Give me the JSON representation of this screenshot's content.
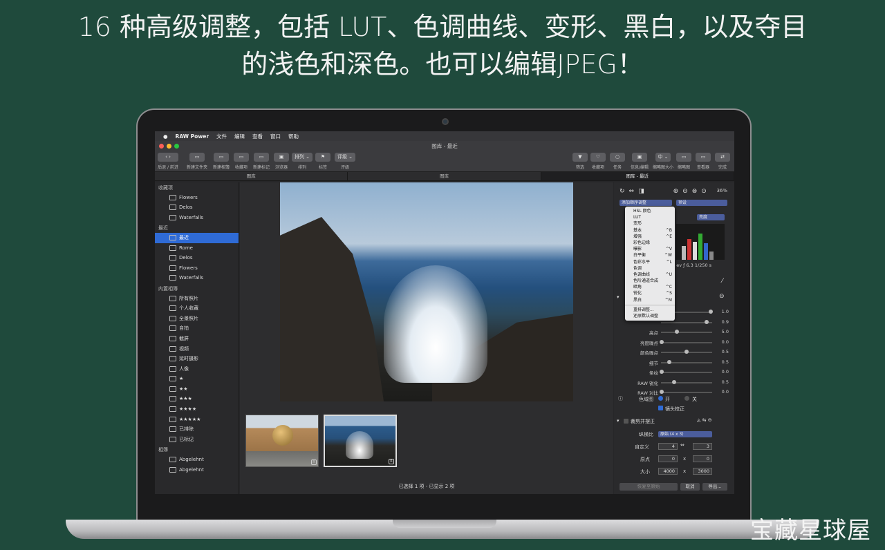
{
  "headline": {
    "line1": "16 种高级调整，包括 LUT、色调曲线、变形、黑白，以及夺目",
    "line2": "的浅色和深色。也可以编辑JPEG！"
  },
  "menubar": {
    "app": "RAW Power",
    "items": [
      "文件",
      "编辑",
      "查看",
      "窗口",
      "帮助"
    ]
  },
  "window": {
    "title": "图库 - 最近"
  },
  "toolbar": {
    "left": [
      {
        "label": "后退 / 前进",
        "icon": "‹ ›"
      },
      {
        "label": "新建文件夹",
        "icon": "▭"
      },
      {
        "label": "新建相簿",
        "icon": "▭"
      },
      {
        "label": "收藏项",
        "icon": "▭"
      },
      {
        "label": "新建标记",
        "icon": "▭"
      },
      {
        "label": "浏览器",
        "icon": "▣"
      },
      {
        "label": "排列",
        "icon": "排列 ⌄"
      },
      {
        "label": "标签",
        "icon": "⚑"
      },
      {
        "label": "评级",
        "icon": "评级 ⌄"
      }
    ],
    "right": [
      {
        "label": "筛选",
        "icon": "▼"
      },
      {
        "label": "收藏项",
        "icon": "♡"
      },
      {
        "label": "任务",
        "icon": "○"
      },
      {
        "label": "信息/编辑",
        "icon": "▣"
      },
      {
        "label": "缩略图大小",
        "icon": "中 ⌄"
      },
      {
        "label": "缩略图",
        "icon": "▭"
      },
      {
        "label": "查看器",
        "icon": "▭"
      },
      {
        "label": "完成",
        "icon": "⇄"
      }
    ]
  },
  "tabs": [
    "图库",
    "图库",
    "图库 - 最近"
  ],
  "sidebar": {
    "sections": [
      {
        "title": "收藏项",
        "items": [
          "Flowers",
          "Delos",
          "Waterfalls"
        ]
      },
      {
        "title": "最近",
        "items": [
          "最近",
          "Rome",
          "Delos",
          "Flowers",
          "Waterfalls"
        ]
      },
      {
        "title": "内置相簿",
        "items": [
          "所有照片",
          "个人收藏",
          "全景照片",
          "自拍",
          "截屏",
          "视频",
          "延时摄影",
          "人像",
          "★",
          "★★",
          "★★★",
          "★★★★",
          "★★★★★",
          "已排除",
          "已标记"
        ]
      },
      {
        "title": "相簿",
        "items": [
          "Abgelehnt",
          "Abgelehnt"
        ]
      }
    ],
    "selected": "最近"
  },
  "main": {
    "status": "已选择 1 项 - 已显示 2 项",
    "thumb_badge": "R"
  },
  "right": {
    "zoom": "36%",
    "combo_left": "添加顺序调整",
    "combo_right": "预设",
    "histogram_mode": "亮度",
    "exif": "0 ev  ƒ 6.3  1/250 s",
    "sliders": [
      {
        "label": "",
        "value": "1.0",
        "pos": 0.98
      },
      {
        "label": "",
        "value": "0.9",
        "pos": 0.9
      },
      {
        "label": "高点",
        "value": "5.0",
        "pos": 0.3
      },
      {
        "label": "亮度噪点",
        "value": "0.0",
        "pos": 0.0
      },
      {
        "label": "颜色噪点",
        "value": "0.5",
        "pos": 0.5
      },
      {
        "label": "细节",
        "value": "0.5",
        "pos": 0.15
      },
      {
        "label": "条纹",
        "value": "0.0",
        "pos": 0.0
      },
      {
        "label": "RAW 锐化",
        "value": "0.5",
        "pos": 0.25
      },
      {
        "label": "RAW 对比",
        "value": "0.0",
        "pos": 0.0
      }
    ],
    "color_map": "色域图",
    "on": "开",
    "off": "关",
    "lens_correction": "镜头校正",
    "crop_section": "裁剪并摆正",
    "aspect_label": "纵横比",
    "aspect_value": "原始 (4 x 3)",
    "custom_label": "自定义",
    "custom_w": "4",
    "custom_h": "3",
    "origin_label": "原点",
    "origin_x": "0",
    "origin_y": "0",
    "size_label": "大小",
    "size_w": "4000",
    "size_h": "3000",
    "times": "x",
    "restore_btn": "恢复至原始",
    "cancel_btn": "取消",
    "export_btn": "导出…"
  },
  "adjust_menu": [
    {
      "label": "HSL 颜色",
      "shortcut": ""
    },
    {
      "label": "LUT",
      "shortcut": ""
    },
    {
      "label": "变形",
      "shortcut": ""
    },
    {
      "label": "基本",
      "shortcut": "^B"
    },
    {
      "label": "增强",
      "shortcut": "^E"
    },
    {
      "label": "彩色边缘",
      "shortcut": ""
    },
    {
      "label": "曝影",
      "shortcut": "^V"
    },
    {
      "label": "白平衡",
      "shortcut": "^W"
    },
    {
      "label": "色彩水平",
      "shortcut": "^L"
    },
    {
      "label": "色调",
      "shortcut": ""
    },
    {
      "label": "色调曲线",
      "shortcut": "^U"
    },
    {
      "label": "色阶通道合成",
      "shortcut": ""
    },
    {
      "label": "暗角",
      "shortcut": "^C"
    },
    {
      "label": "锐化",
      "shortcut": "^S"
    },
    {
      "label": "黑白",
      "shortcut": "^M"
    },
    {
      "sep": true
    },
    {
      "label": "重排调整...",
      "shortcut": ""
    },
    {
      "label": "还原默认调整",
      "shortcut": ""
    }
  ],
  "watermark": "宝藏星球屋",
  "colors": {
    "background": "#1f4a3c",
    "selection": "#2f6bd6"
  }
}
